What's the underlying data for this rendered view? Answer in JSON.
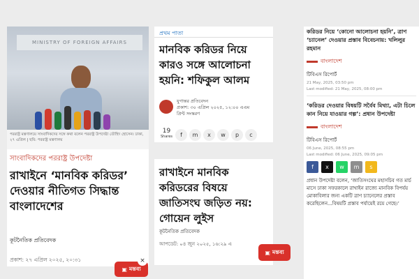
{
  "panel1": {
    "photo_banner": "MINISTRY OF FOREIGN AFFAIRS",
    "photo_caption": "পররাষ্ট্র মন্ত্রণালয়ে সাংবাদিকদের সঙ্গে কথা বলেন পররাষ্ট্র উপদেষ্টা তৌহিদ হোসেন। ঢাকা, ২৭ এপ্রিল | ছবি: পররাষ্ট্র মন্ত্রণালয়",
    "topic": "সাংবাদিকদের পররাষ্ট্র উপদেষ্টা",
    "headline": "রাখাইনে ‘মানবিক করিডর’ দেওয়ার নীতিগত সিদ্ধান্ত বাংলাদেশের",
    "author": "কূটনৈতিক প্রতিবেদক",
    "date": "প্রকাশ: ২৭ এপ্রিল ২০২৫, ২০:৩১",
    "comment_label": "মন্তব্য",
    "close_label": "×"
  },
  "panel2": {
    "category": "প্রথম পাতা",
    "headline": "মানবিক করিডর নিয়ে কারও সঙ্গে আলোচনা হয়নি: শফিকুল আলম",
    "author": "যুগান্তর প্রতিবেদন",
    "published": "প্রকাশ: ৩০ এপ্রিল ২০২৫, ১২:০০ এএম",
    "print_version": "প্রিন্ট সংস্করণ",
    "share_count": "19",
    "share_label": "Shares",
    "share_icons": [
      "f",
      "m",
      "x",
      "w",
      "p",
      "c"
    ]
  },
  "panel3": {
    "headline": "রাখাইনে মানবিক করিডরের বিষয়ে জাতিসংঘ জড়িত নয়: গোয়েন লুইস",
    "author": "কূটনৈতিক প্রতিবেদক",
    "date": "আপডেট: ০৪ জুন ২০২৫, ১৬:২৯ এ",
    "comment_label": "মন্তব্য"
  },
  "panel4": {
    "top_text": "করিডর নিয়ে ‘কোনো আলোচনা হয়নি’, ত্রাণ ‘চ্যানেল’ দেওয়ার প্রস্তাব বিবেচনায়: খলিলুর রহমান",
    "section1": "বাংলাদেশ",
    "report1": "টিবিএস রিপোর্ট",
    "date1_a": "21 May, 2025, 03:50 pm",
    "date1_b": "Last modified: 21 May, 2025, 08:00 pm",
    "headline2": "‘করিডর দেওয়ার বিষয়টি সর্বৈব মিথ্যা, এটা চিলে কান নিয়ে যাওয়ার গল্প’: প্রধান উপদেষ্টা",
    "section2": "বাংলাদেশ",
    "report2": "টিবিএস রিপোর্ট",
    "date2_a": "06 June, 2025, 08:55 pm",
    "date2_b": "Last modified: 06 June, 2025, 09:05 pm",
    "social": [
      "f",
      "x",
      "w",
      "m",
      "s"
    ],
    "body": "প্রধান উপদেষ্টা বলেন, ‘জাতিসংঘের মহাসচিব গত মার্চ মাসে ঢাকা সফরকালে রাখাইন রাজ্যে মানবিক বিপর্যয় মোকাবিলার জন্য একটি ত্রাণ চ্যানেলের প্রস্তাব করেছিলেন...বিষয়টি প্রস্তাব পর্যায়েই রয়ে গেছে।’"
  },
  "colors": {
    "accent_red": "#d9312a",
    "link_blue": "#1e6fbf",
    "facebook": "#3b5998",
    "x": "#111111",
    "whatsapp": "#25d366",
    "email": "#8e8e8e",
    "sms": "#f2b81c"
  }
}
